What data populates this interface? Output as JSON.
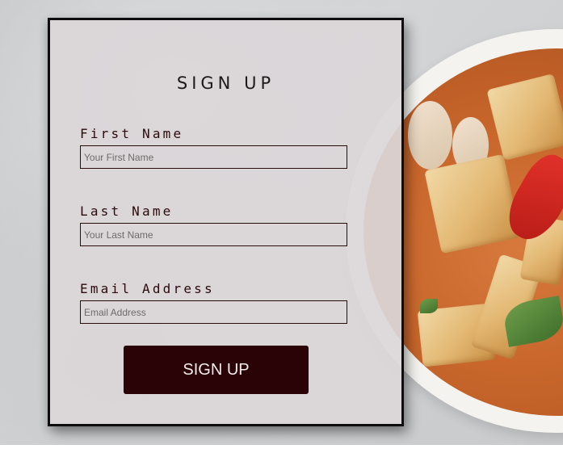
{
  "form": {
    "title": "SIGN UP",
    "fields": [
      {
        "label": "First Name",
        "placeholder": "Your First Name",
        "value": ""
      },
      {
        "label": "Last Name",
        "placeholder": "Your Last Name",
        "value": ""
      },
      {
        "label": "Email Address",
        "placeholder": "Email Address",
        "value": ""
      }
    ],
    "submit_label": "SIGN UP"
  },
  "colors": {
    "button_bg": "#2a0306",
    "label_text": "#2b0a0c",
    "card_bg": "#dcd6d8",
    "card_border": "#0d0d0d"
  },
  "background_image": {
    "icon": "thai-red-curry-bowl-photo"
  }
}
